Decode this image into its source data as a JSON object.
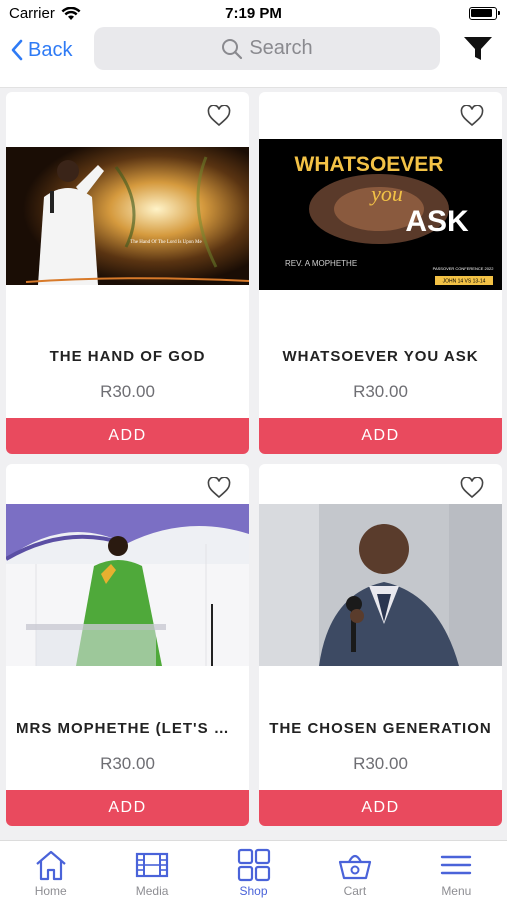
{
  "status_bar": {
    "carrier": "Carrier",
    "time": "7:19 PM"
  },
  "nav": {
    "back_label": "Back",
    "search_placeholder": "Search"
  },
  "products": [
    {
      "title": "THE HAND OF GOD",
      "price": "R30.00",
      "add_label": "ADD",
      "thumb_caption": "The Hand Of The Lord Is Upon Me"
    },
    {
      "title": "WHATSOEVER YOU ASK",
      "price": "R30.00",
      "add_label": "ADD",
      "thumb_word1": "WHATSOEVER",
      "thumb_word2": "you",
      "thumb_word3": "ASK",
      "thumb_author": "REV. A MOPHETHE",
      "thumb_event": "PASSOVER CONFERENCE 2022",
      "thumb_ref": "JOHN 14 VS 13-14"
    },
    {
      "title": "MRS MOPHETHE (LET'S D...",
      "price": "R30.00",
      "add_label": "ADD"
    },
    {
      "title": "THE CHOSEN GENERATION",
      "price": "R30.00",
      "add_label": "ADD"
    }
  ],
  "tabs": [
    {
      "label": "Home",
      "icon": "house-icon"
    },
    {
      "label": "Media",
      "icon": "film-icon"
    },
    {
      "label": "Shop",
      "icon": "grid-icon",
      "active": true
    },
    {
      "label": "Cart",
      "icon": "basket-icon"
    },
    {
      "label": "Menu",
      "icon": "hamburger-icon"
    }
  ],
  "colors": {
    "accent": "#2f7bf5",
    "add_button": "#e94a5e",
    "tab_active": "#4a63d9",
    "tab_inactive": "#8e8e93"
  }
}
